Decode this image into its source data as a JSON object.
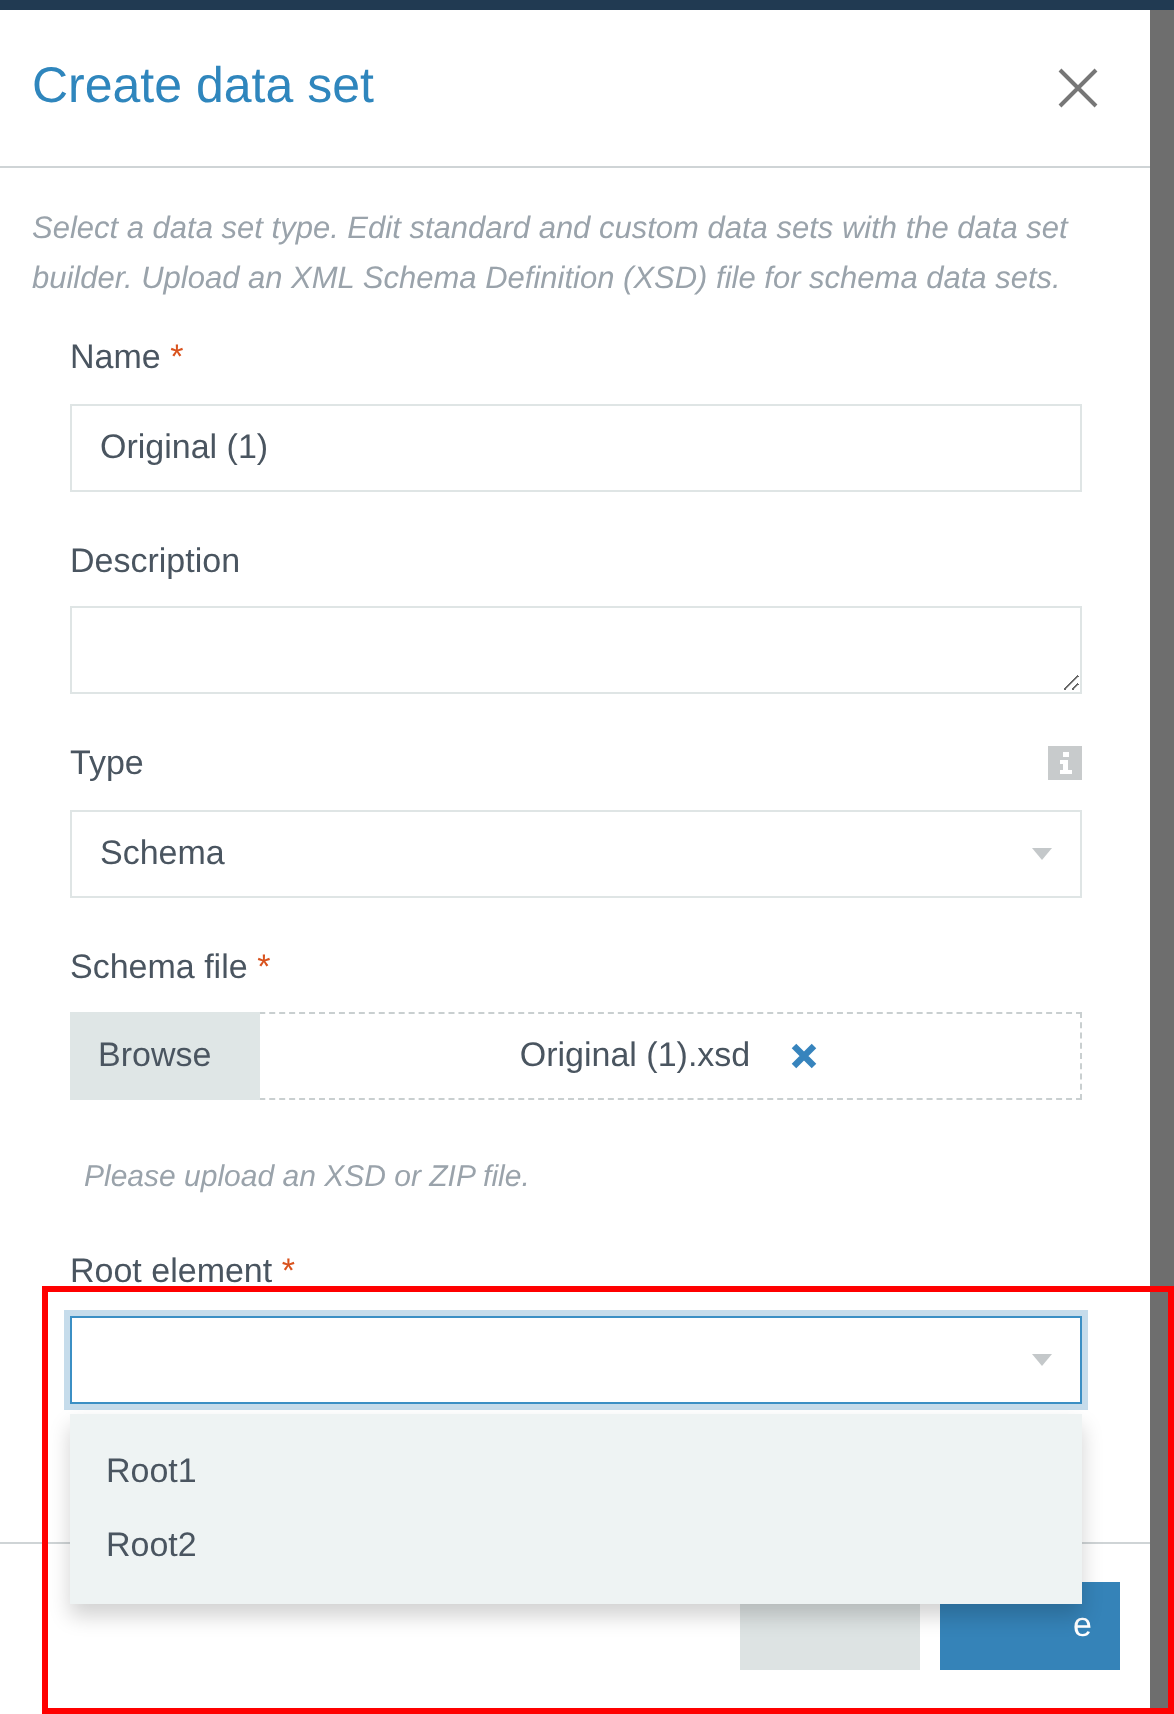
{
  "dialog": {
    "title": "Create data set",
    "intro": "Select a data set type. Edit standard and custom data sets with the data set builder. Upload an XML Schema Definition (XSD) file for schema data sets.",
    "fields": [
      {
        "kind": "text",
        "label": "Name",
        "required_mark": "*",
        "value": "Original (1)"
      },
      {
        "kind": "textarea",
        "label": "Description"
      },
      {
        "kind": "select",
        "label": "Type",
        "info": true,
        "value": "Schema"
      },
      {
        "kind": "file",
        "label": "Schema file",
        "required_mark": "*",
        "button": "Browse",
        "file": "Original (1).xsd",
        "hint": "Please upload an XSD or ZIP file."
      },
      {
        "kind": "select",
        "label": "Root element",
        "required_mark": "*",
        "focused": true,
        "options": [
          {
            "label": "Root1",
            "selected": false
          },
          {
            "label": "Root2",
            "selected": false
          }
        ]
      }
    ],
    "footer": {
      "primary_button": "e"
    }
  },
  "highlight": true
}
